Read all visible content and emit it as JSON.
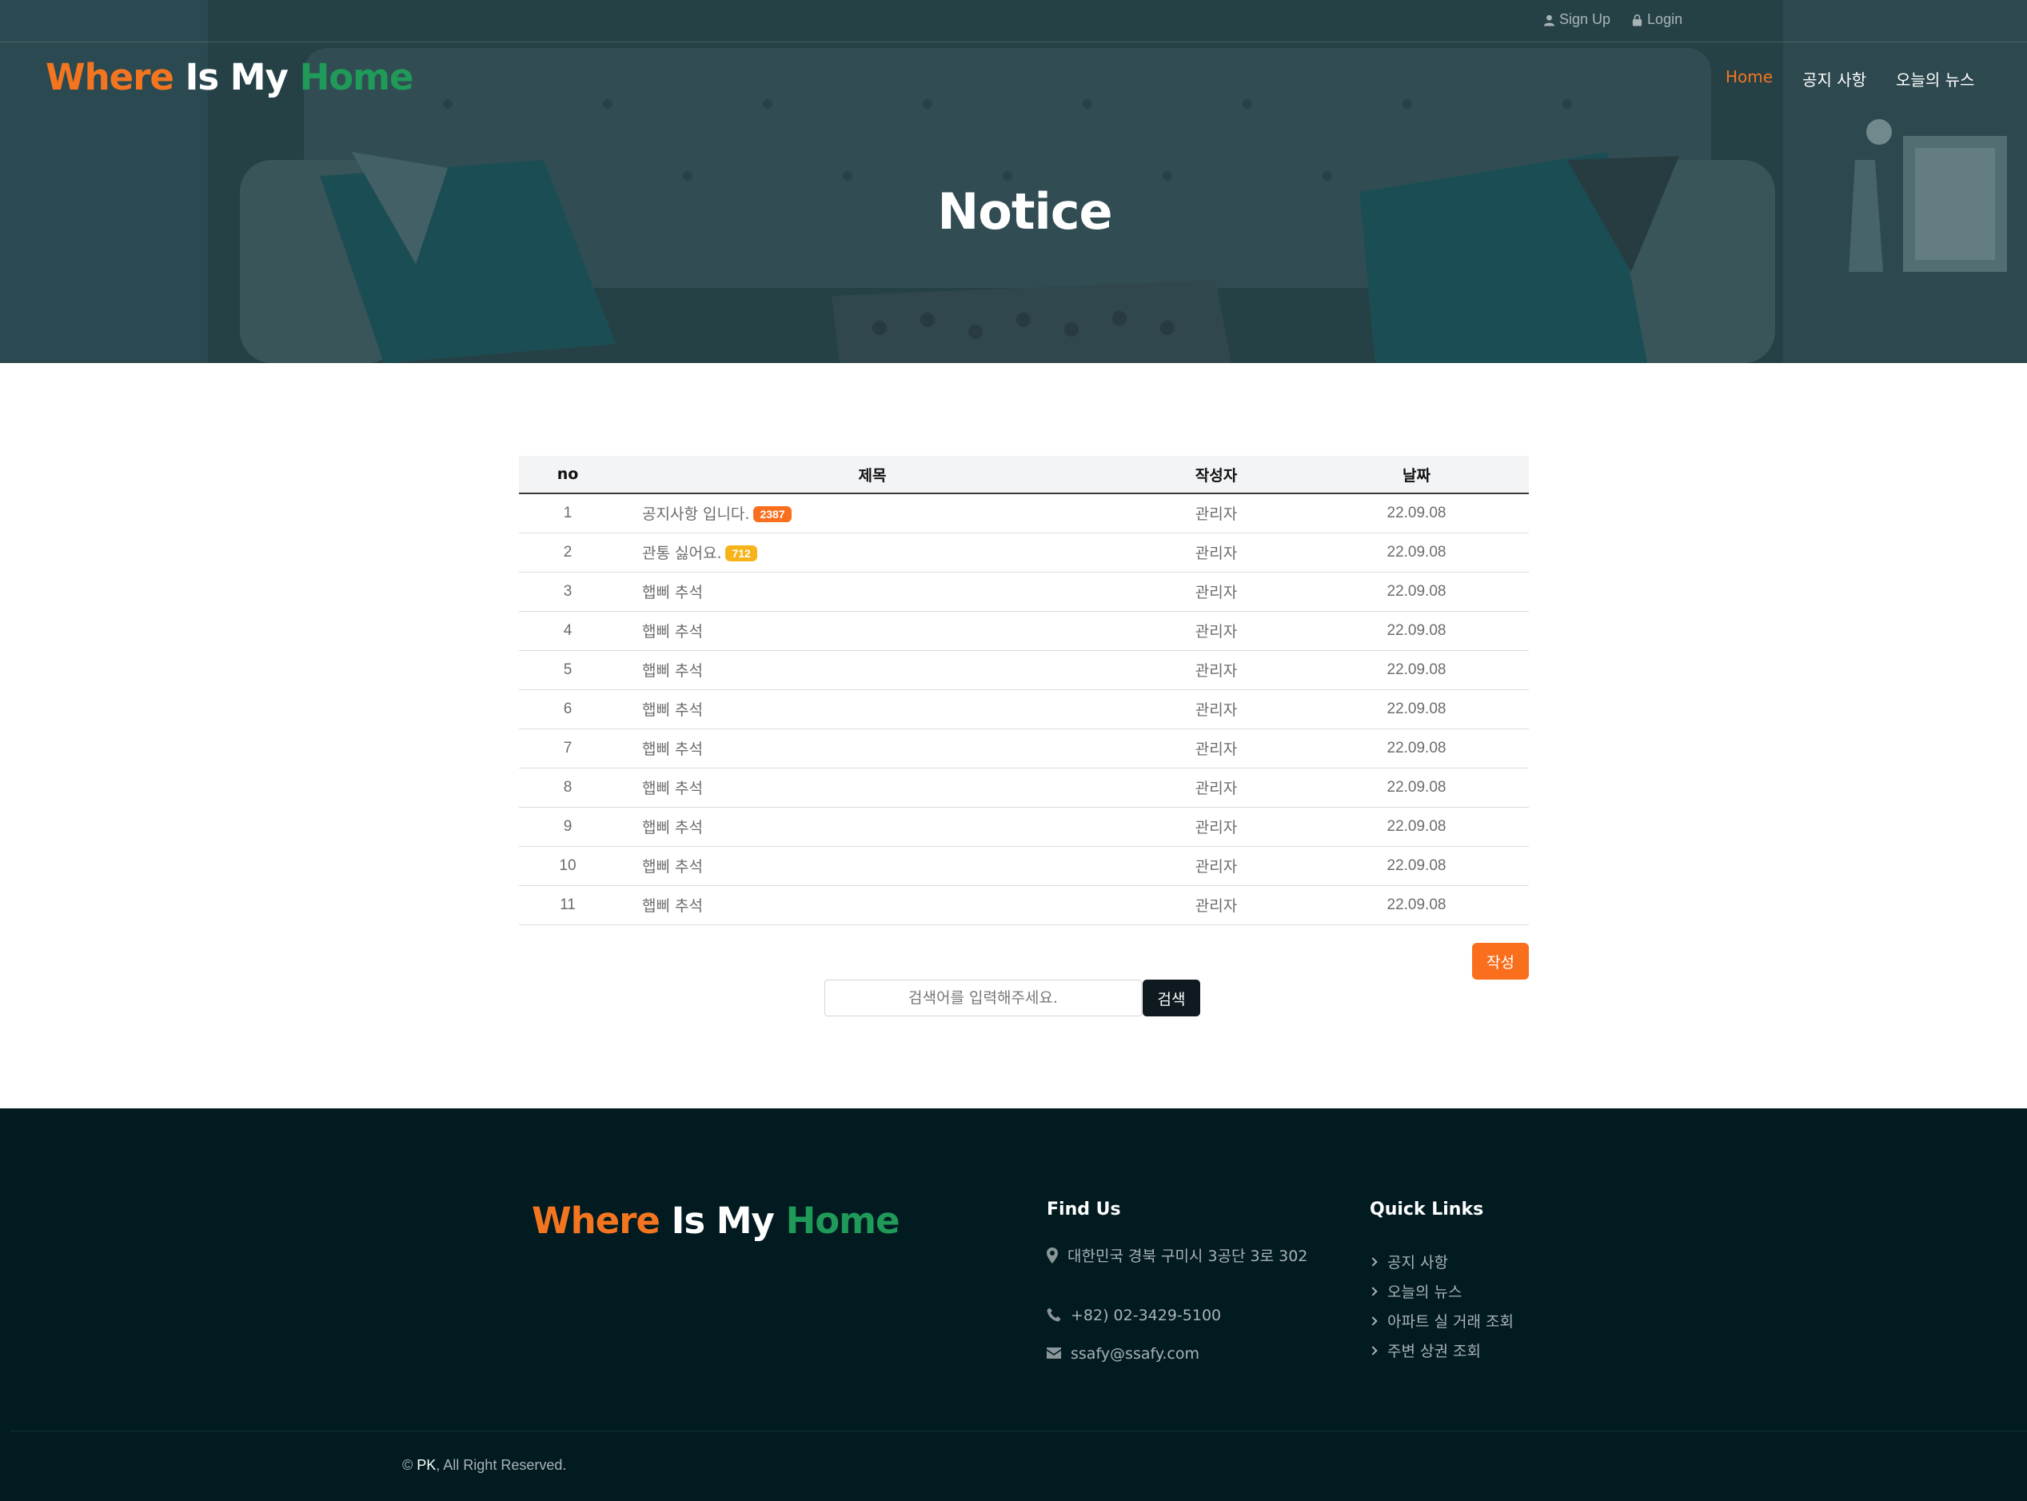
{
  "topbar": {
    "signup_label": "Sign Up",
    "login_label": "Login"
  },
  "brand": {
    "word1": "Where",
    "word2": "Is",
    "word3": "My",
    "word4": "Home"
  },
  "nav": {
    "items": [
      {
        "label": "Home",
        "active": true
      },
      {
        "label": "공지 사항",
        "active": false
      },
      {
        "label": "오늘의 뉴스",
        "active": false
      }
    ]
  },
  "hero": {
    "title": "Notice"
  },
  "table": {
    "headers": [
      "no",
      "제목",
      "작성자",
      "날짜"
    ],
    "rows": [
      {
        "no": "1",
        "title": "공지사항 입니다.",
        "badge": "2387",
        "badge_color": "#fa6f1d",
        "writer": "관리자",
        "date": "22.09.08"
      },
      {
        "no": "2",
        "title": "관통 싫어요.",
        "badge": "712",
        "badge_color": "#f7b41a",
        "writer": "관리자",
        "date": "22.09.08"
      },
      {
        "no": "3",
        "title": "햅삐 추석",
        "badge": "",
        "writer": "관리자",
        "date": "22.09.08"
      },
      {
        "no": "4",
        "title": "햅삐 추석",
        "badge": "",
        "writer": "관리자",
        "date": "22.09.08"
      },
      {
        "no": "5",
        "title": "햅삐 추석",
        "badge": "",
        "writer": "관리자",
        "date": "22.09.08"
      },
      {
        "no": "6",
        "title": "햅삐 추석",
        "badge": "",
        "writer": "관리자",
        "date": "22.09.08"
      },
      {
        "no": "7",
        "title": "햅삐 추석",
        "badge": "",
        "writer": "관리자",
        "date": "22.09.08"
      },
      {
        "no": "8",
        "title": "햅삐 추석",
        "badge": "",
        "writer": "관리자",
        "date": "22.09.08"
      },
      {
        "no": "9",
        "title": "햅삐 추석",
        "badge": "",
        "writer": "관리자",
        "date": "22.09.08"
      },
      {
        "no": "10",
        "title": "햅삐 추석",
        "badge": "",
        "writer": "관리자",
        "date": "22.09.08"
      },
      {
        "no": "11",
        "title": "햅삐 추석",
        "badge": "",
        "writer": "관리자",
        "date": "22.09.08"
      }
    ]
  },
  "actions": {
    "write_label": "작성",
    "search_placeholder": "검색어를 입력해주세요.",
    "search_label": "검색"
  },
  "footer": {
    "find_us_title": "Find Us",
    "address": "대한민국 경북 구미시 3공단 3로 302",
    "phone": "+82) 02-3429-5100",
    "email": "ssafy@ssafy.com",
    "quick_links_title": "Quick Links",
    "quick_links": [
      "공지 사항",
      "오늘의 뉴스",
      "아파트 실 거래 조회",
      "주변 상권 조회"
    ],
    "copyright_prefix": "© ",
    "copyright_owner": "PK",
    "copyright_suffix": ", All Right Reserved."
  },
  "colors": {
    "accent_orange": "#f47520",
    "accent_green": "#1f9a58",
    "footer_bg": "#011b21",
    "hero_overlay": "#1f3a40"
  }
}
